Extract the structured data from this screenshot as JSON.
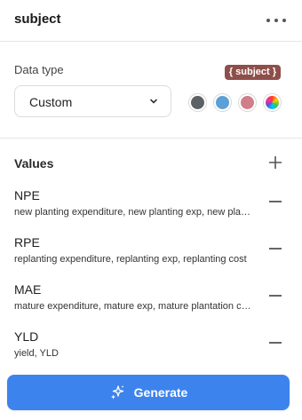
{
  "header": {
    "title": "subject"
  },
  "data_type": {
    "label": "Data type",
    "tag": "{ subject }",
    "selected": "Custom",
    "swatch_colors": [
      "#5c6166",
      "#5ba0d6",
      "#d07e8a",
      "rainbow"
    ]
  },
  "values": {
    "label": "Values",
    "items": [
      {
        "name": "NPE",
        "synonyms": "new planting expenditure, new planting exp, new planting cost"
      },
      {
        "name": "RPE",
        "synonyms": "replanting expenditure, replanting exp, replanting cost"
      },
      {
        "name": "MAE",
        "synonyms": "mature expenditure, mature exp, mature plantation cost"
      },
      {
        "name": "YLD",
        "synonyms": "yield, YLD"
      }
    ]
  },
  "generate": {
    "label": "Generate"
  }
}
